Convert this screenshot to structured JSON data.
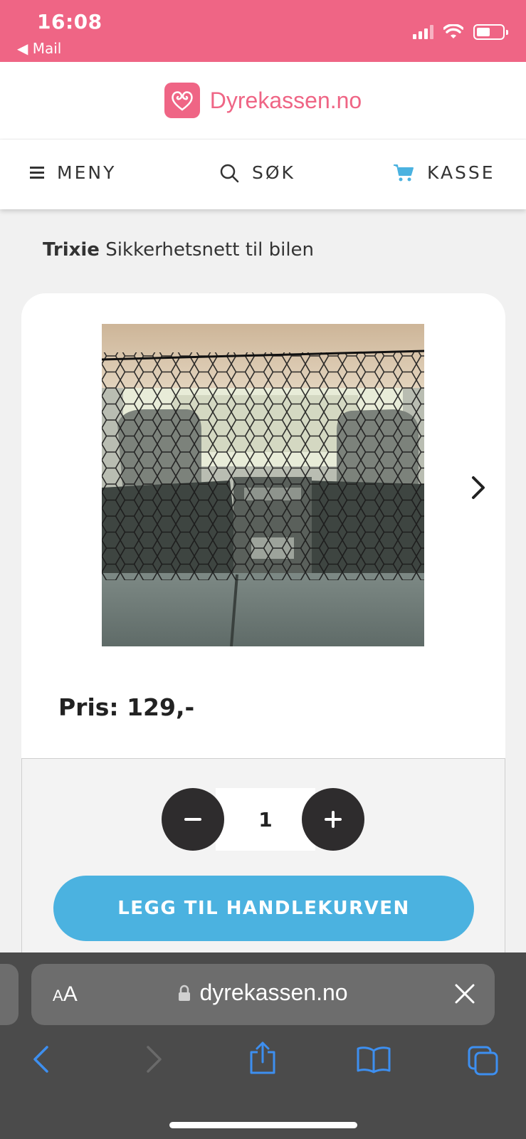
{
  "status_bar": {
    "time": "16:08",
    "back_app": "◀ Mail",
    "color": "#ef6585"
  },
  "header": {
    "logo_text": "Dyrekassen.no",
    "brand_color": "#ef6585"
  },
  "nav": {
    "menu_label": "MENY",
    "search_label": "SØK",
    "cart_label": "KASSE"
  },
  "product": {
    "brand": "Trixie",
    "name": "Sikkerhetsnett til bilen",
    "price": "Pris: 129,-",
    "quantity": "1",
    "add_to_cart_label": "LEGG TIL HANDLEKURVEN",
    "add_button_color": "#4bb2e0"
  },
  "browser": {
    "text_size_small": "A",
    "text_size_big": "A",
    "url": "dyrekassen.no",
    "icons": [
      "back-icon",
      "forward-icon",
      "share-icon",
      "bookmarks-icon",
      "tabs-icon"
    ],
    "accent": "#3d8ff0"
  }
}
